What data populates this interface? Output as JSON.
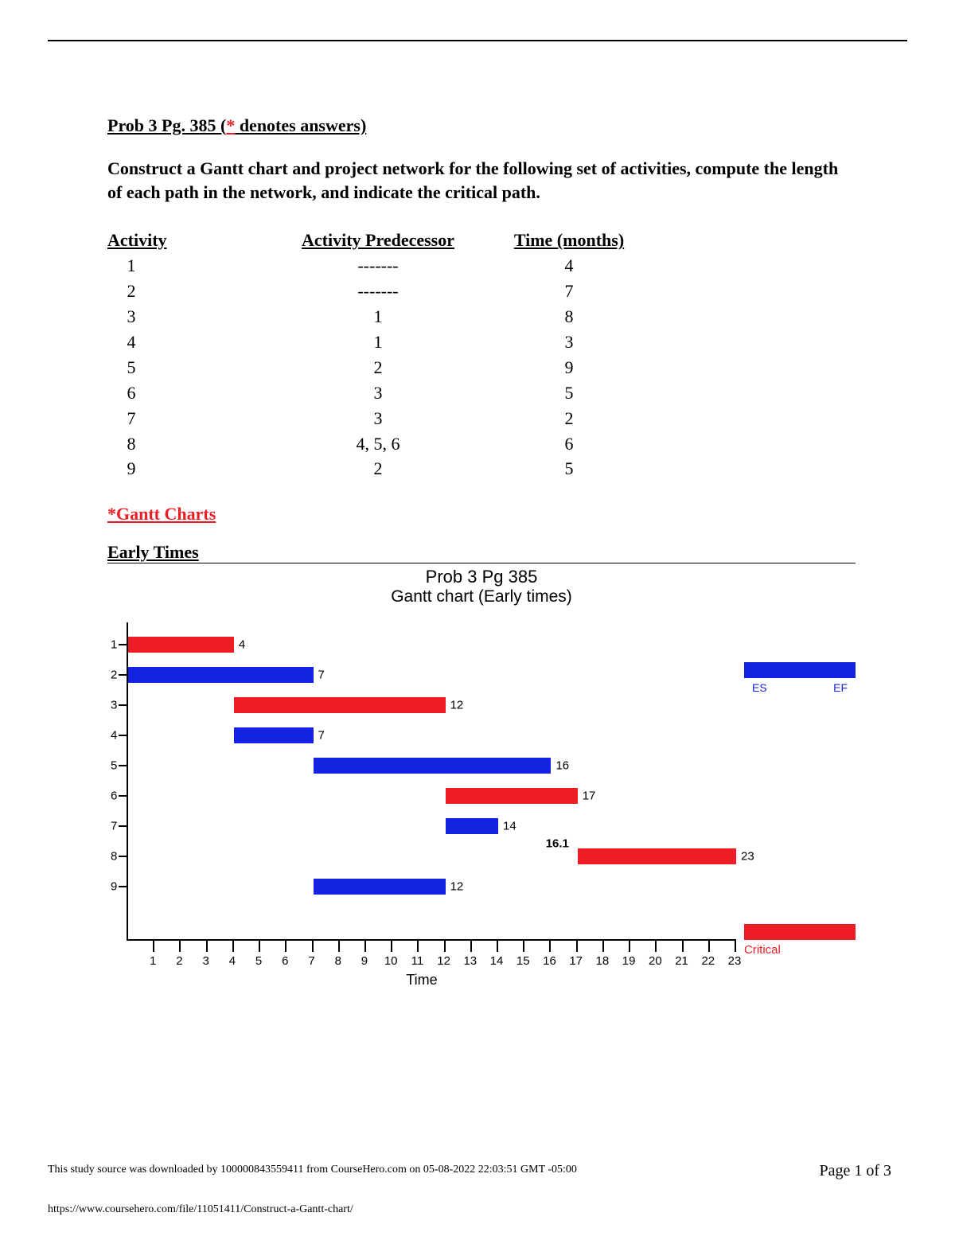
{
  "header": {
    "title_prefix": "Prob 3 Pg. 385 (",
    "asterisk": "*",
    "title_suffix": " denotes answers)",
    "description": "Construct a Gantt chart and project network for the following set of activities, compute the length of each path in the network, and indicate the critical path."
  },
  "table": {
    "headers": {
      "activity": "Activity",
      "predecessor": "Activity Predecessor",
      "time": "Time (months)"
    },
    "rows": [
      {
        "activity": "1",
        "predecessor": "-------",
        "time": "4"
      },
      {
        "activity": "2",
        "predecessor": "-------",
        "time": "7"
      },
      {
        "activity": "3",
        "predecessor": "1",
        "time": "8"
      },
      {
        "activity": "4",
        "predecessor": "1",
        "time": "3"
      },
      {
        "activity": "5",
        "predecessor": "2",
        "time": "9"
      },
      {
        "activity": "6",
        "predecessor": "3",
        "time": "5"
      },
      {
        "activity": "7",
        "predecessor": "3",
        "time": "2"
      },
      {
        "activity": "8",
        "predecessor": "4, 5, 6",
        "time": "6"
      },
      {
        "activity": "9",
        "predecessor": "2",
        "time": "5"
      }
    ]
  },
  "sections": {
    "gantt_heading": "*Gantt Charts",
    "early_heading": "Early Times"
  },
  "chart_data": {
    "type": "gantt",
    "title": "Prob 3 Pg 385",
    "subtitle": "Gantt chart (Early times)",
    "xlabel": "Time",
    "xlim": [
      0,
      23
    ],
    "activities": [
      "1",
      "2",
      "3",
      "4",
      "5",
      "6",
      "7",
      "8",
      "9"
    ],
    "bars": [
      {
        "activity": "1",
        "start": 0,
        "end": 4,
        "label": "4",
        "critical": true
      },
      {
        "activity": "2",
        "start": 0,
        "end": 7,
        "label": "7",
        "critical": false
      },
      {
        "activity": "3",
        "start": 4,
        "end": 12,
        "label": "12",
        "critical": true
      },
      {
        "activity": "4",
        "start": 4,
        "end": 7,
        "label": "7",
        "critical": false
      },
      {
        "activity": "5",
        "start": 7,
        "end": 16,
        "label": "16",
        "critical": false
      },
      {
        "activity": "6",
        "start": 12,
        "end": 17,
        "label": "17",
        "critical": true
      },
      {
        "activity": "7",
        "start": 12,
        "end": 14,
        "label": "14",
        "critical": false
      },
      {
        "activity": "8",
        "start": 17,
        "end": 23,
        "label": "23",
        "critical": true,
        "annotation": "16.1"
      },
      {
        "activity": "9",
        "start": 7,
        "end": 12,
        "label": "12",
        "critical": false
      }
    ],
    "legend": {
      "es": "ES",
      "ef": "EF",
      "critical": "Critical"
    }
  },
  "footer": {
    "note": "This study source was downloaded by 100000843559411 from CourseHero.com on 05-08-2022 22:03:51 GMT -05:00",
    "page": "Page 1 of 3",
    "url": "https://www.coursehero.com/file/11051411/Construct-a-Gantt-chart/"
  }
}
